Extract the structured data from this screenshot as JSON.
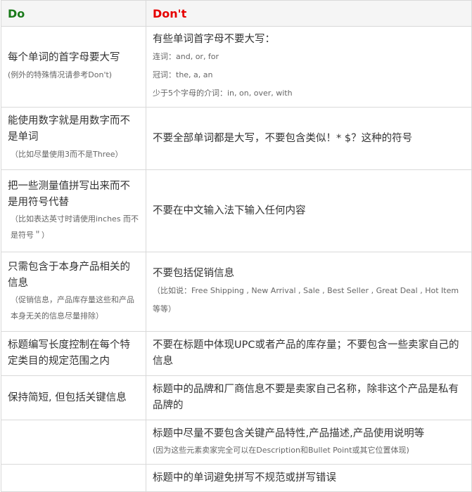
{
  "header": {
    "do": "Do",
    "dont": "Don't"
  },
  "colors": {
    "do_header": "#1a7a1a",
    "dont_header": "#e60000",
    "border": "#d9d9d9",
    "header_bg": "#f5f5f5"
  },
  "rows": [
    {
      "do_main": "每个单词的首字母要大写",
      "do_note": "(例外的特殊情况请参考Don't)",
      "dont_main": "有些单词首字母不要大写：",
      "dont_notes": [
        "连词：and, or, for",
        "冠词：the, a, an",
        "少于5个字母的介词：in, on, over, with"
      ]
    },
    {
      "do_main": "能使用数字就是用数字而不是单词",
      "do_note": "（比如尽量使用3而不是Three）",
      "dont_main": "不要全部单词都是大写，不要包含类似！* $？这种的符号"
    },
    {
      "do_main": "把一些测量值拼写出来而不是用符号代替",
      "do_note": "（比如表达英寸时请使用inches 而不是符号＂）",
      "dont_main": "不要在中文输入法下输入任何内容"
    },
    {
      "do_main": "只需包含于本身产品相关的信息",
      "do_note": "（促销信息，产品库存量这些和产品本身无关的信息尽量排除）",
      "dont_main": "不要包括促销信息",
      "dont_note": "（比如说：Free Shipping , New Arrival , Sale , Best Seller , Great Deal , Hot Item 等等）"
    },
    {
      "do_main": "标题编写长度控制在每个特定类目的规定范围之内",
      "dont_main": "不要在标题中体现UPC或者产品的库存量；不要包含一些卖家自己的信息"
    },
    {
      "do_main": "保持简短, 但包括关键信息",
      "dont_main": "标题中的品牌和厂商信息不要是卖家自己名称，除非这个产品是私有品牌的"
    },
    {
      "do_main": "",
      "dont_main": "标题中尽量不要包含关键产品特性,产品描述,产品使用说明等",
      "dont_note": "(因为这些元素卖家完全可以在Description和Bullet Point或其它位置体现)"
    },
    {
      "do_main": "",
      "dont_main": "标题中的单词避免拼写不规范或拼写错误"
    }
  ]
}
